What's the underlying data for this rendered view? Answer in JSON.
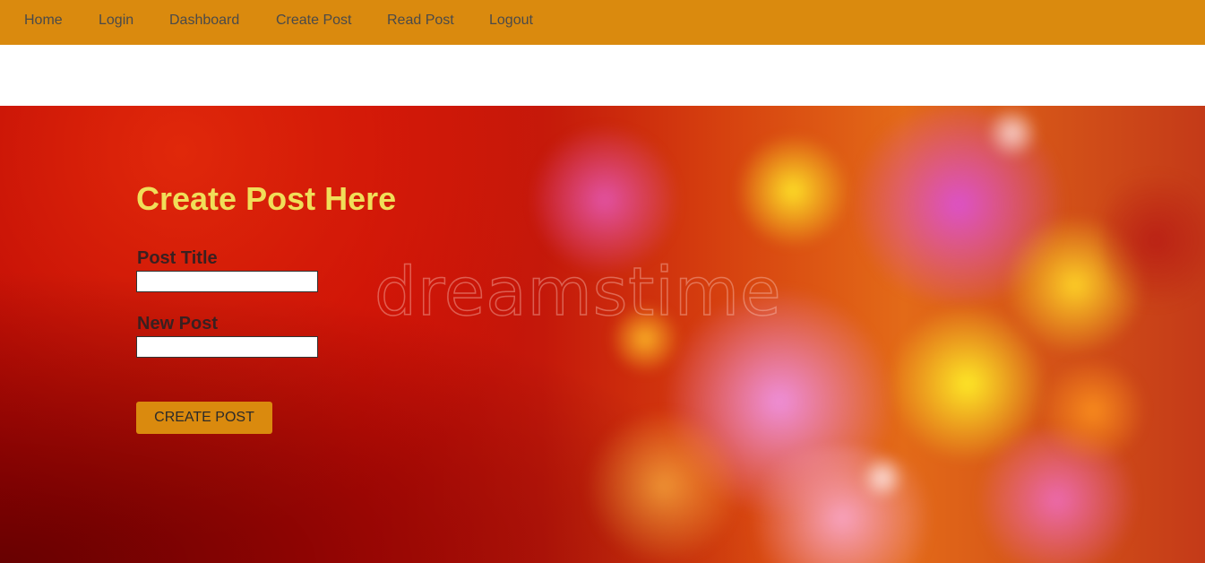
{
  "nav": {
    "items": [
      {
        "label": "Home"
      },
      {
        "label": "Login"
      },
      {
        "label": "Dashboard"
      },
      {
        "label": "Create Post"
      },
      {
        "label": "Read Post"
      },
      {
        "label": "Logout"
      }
    ]
  },
  "hero": {
    "watermark": "dreamstime"
  },
  "form": {
    "title": "Create Post Here",
    "post_title_label": "Post Title",
    "post_title_value": "",
    "new_post_label": "New Post",
    "new_post_value": "",
    "submit_label": "CREATE POST"
  },
  "colors": {
    "nav_background": "#da8a0e",
    "title_color": "#f0de59",
    "button_background": "#da8a0e"
  }
}
